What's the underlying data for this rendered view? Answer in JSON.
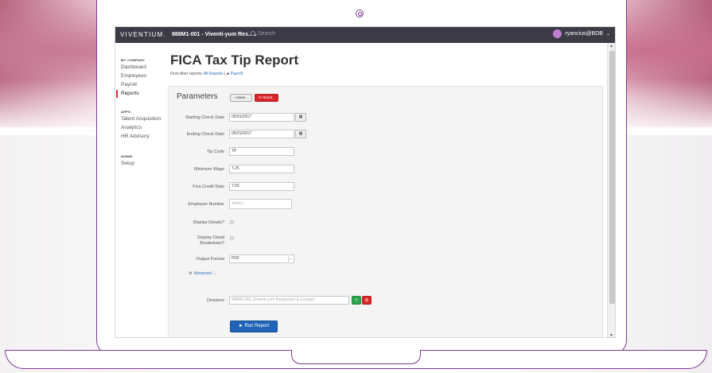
{
  "topbar": {
    "brand": "VIVENTIUM.",
    "company": "988M1-001 - Viventi-yum Res..",
    "company_caret": "⌄",
    "search_placeholder": "Search",
    "user": "ryancius@BDB",
    "user_caret": "⌄"
  },
  "sidebar": {
    "my_company_title": "MY COMPANY",
    "apps_title": "APPS",
    "admin_title": "ADMIN",
    "items": {
      "dashboard": "Dashboard",
      "employees": "Employees",
      "payroll": "Payroll",
      "reports": "Reports",
      "talent": "Talent Acquisition",
      "analytics": "Analytics",
      "hr_advisory": "HR Advisory",
      "setup": "Setup"
    }
  },
  "page": {
    "title": "FICA Tax Tip Report",
    "find_other": "Find other reports:",
    "all_reports": "All Reports",
    "separator": "|",
    "payroll_link": "Payroll"
  },
  "parameters": {
    "title": "Parameters",
    "save_label": "Save..",
    "reset_label": "Reset..",
    "fields": {
      "starting_check_date": {
        "label": "Starting Check Date",
        "value": "05/01/2017"
      },
      "ending_check_date": {
        "label": "Ending Check Date",
        "value": "05/31/2017"
      },
      "tip_code": {
        "label": "Tip Code",
        "value": "TP"
      },
      "minimum_wage": {
        "label": "Minimum Wage",
        "value": "7.25"
      },
      "fica_credit_rate": {
        "label": "Fica Credit Rate",
        "value": "7.65"
      },
      "employee_number": {
        "label": "Employee Number",
        "placeholder": "Select..."
      },
      "display_details": {
        "label": "Display Details?"
      },
      "display_detail_breakdown": {
        "label_line1": "Display Detail",
        "label_line2": "Breakdown?"
      },
      "output_format": {
        "label": "Output Format",
        "value": "PDF"
      },
      "divisions": {
        "label": "Divisions",
        "value": "988M1-001 (Viventi-yum Restaurant & Lounge)"
      }
    },
    "advanced_label": "Advanced ...",
    "add_symbol": "+",
    "remove_symbol": "⊘",
    "run_label": "Run Report",
    "calendar_glyph": "▦",
    "dropdown_glyph": "⬦"
  },
  "colors": {
    "topbar": "#3b3a45",
    "accent_red": "#d9262b",
    "accent_green": "#2da44e",
    "accent_blue": "#1f64b8",
    "frame_purple": "#7d3b8f"
  }
}
